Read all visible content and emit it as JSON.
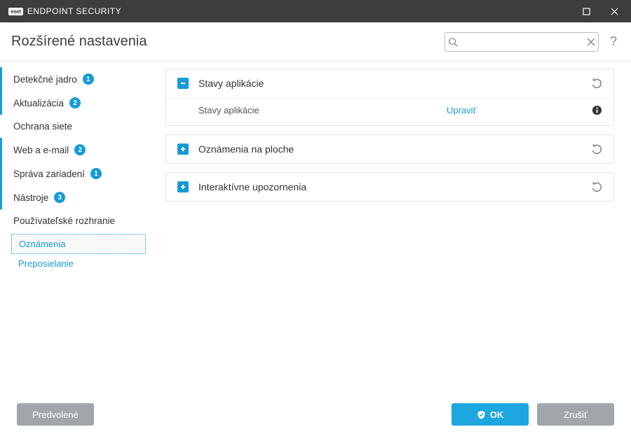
{
  "titlebar": {
    "brand_box": "eset",
    "product": "ENDPOINT SECURITY"
  },
  "header": {
    "title": "Rozšírené nastavenia",
    "search_placeholder": ""
  },
  "sidebar": {
    "items": [
      {
        "label": "Detekčné jadro",
        "badge": "1"
      },
      {
        "label": "Aktualizácia",
        "badge": "2"
      },
      {
        "label": "Ochrana siete",
        "badge": ""
      },
      {
        "label": "Web a e-mail",
        "badge": "2"
      },
      {
        "label": "Správa zariadení",
        "badge": "1"
      },
      {
        "label": "Nástroje",
        "badge": "3"
      },
      {
        "label": "Používateľské rozhranie",
        "badge": ""
      }
    ],
    "sub": [
      {
        "label": "Oznámenia"
      },
      {
        "label": "Preposielanie"
      }
    ]
  },
  "panels": {
    "p0": {
      "title": "Stavy aplikácie",
      "row_label": "Stavy aplikácie",
      "row_value": "Upraviť"
    },
    "p1": {
      "title": "Oznámenia na ploche"
    },
    "p2": {
      "title": "Interaktívne upozornenia"
    }
  },
  "footer": {
    "default": "Predvolené",
    "ok": "OK",
    "cancel": "Zrušiť"
  }
}
